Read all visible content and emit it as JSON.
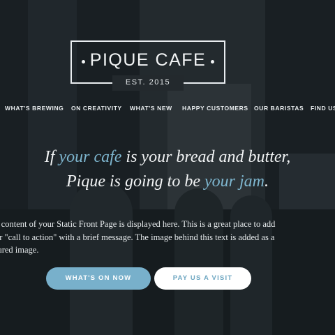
{
  "logo": {
    "title": "PIQUE CAFE",
    "subtitle": "EST. 2015"
  },
  "nav": {
    "items": [
      "WHAT'S BREWING",
      "ON CREATIVITY",
      "WHAT'S NEW",
      "HAPPY CUSTOMERS",
      "OUR BARISTAS",
      "FIND US"
    ]
  },
  "hero": {
    "line1_pre": "If ",
    "line1_accent": "your cafe",
    "line1_post": " is your bread and butter,",
    "line2_pre": "Pique is going to be ",
    "line2_accent": "your jam",
    "line2_post": ".",
    "body_line1": "e content of your Static Front Page is displayed here. This is a great place to add",
    "body_line2": "ur \"call to action\" with a brief message. The image behind this text is added as a",
    "body_line3": "tured image."
  },
  "buttons": {
    "primary": "WHAT'S ON NOW",
    "secondary": "PAY US A VISIT"
  },
  "colors": {
    "accent": "#7eb6cf",
    "button_primary": "#78b0cb",
    "button_secondary_bg": "#ffffff",
    "text": "#f1f3f4"
  }
}
